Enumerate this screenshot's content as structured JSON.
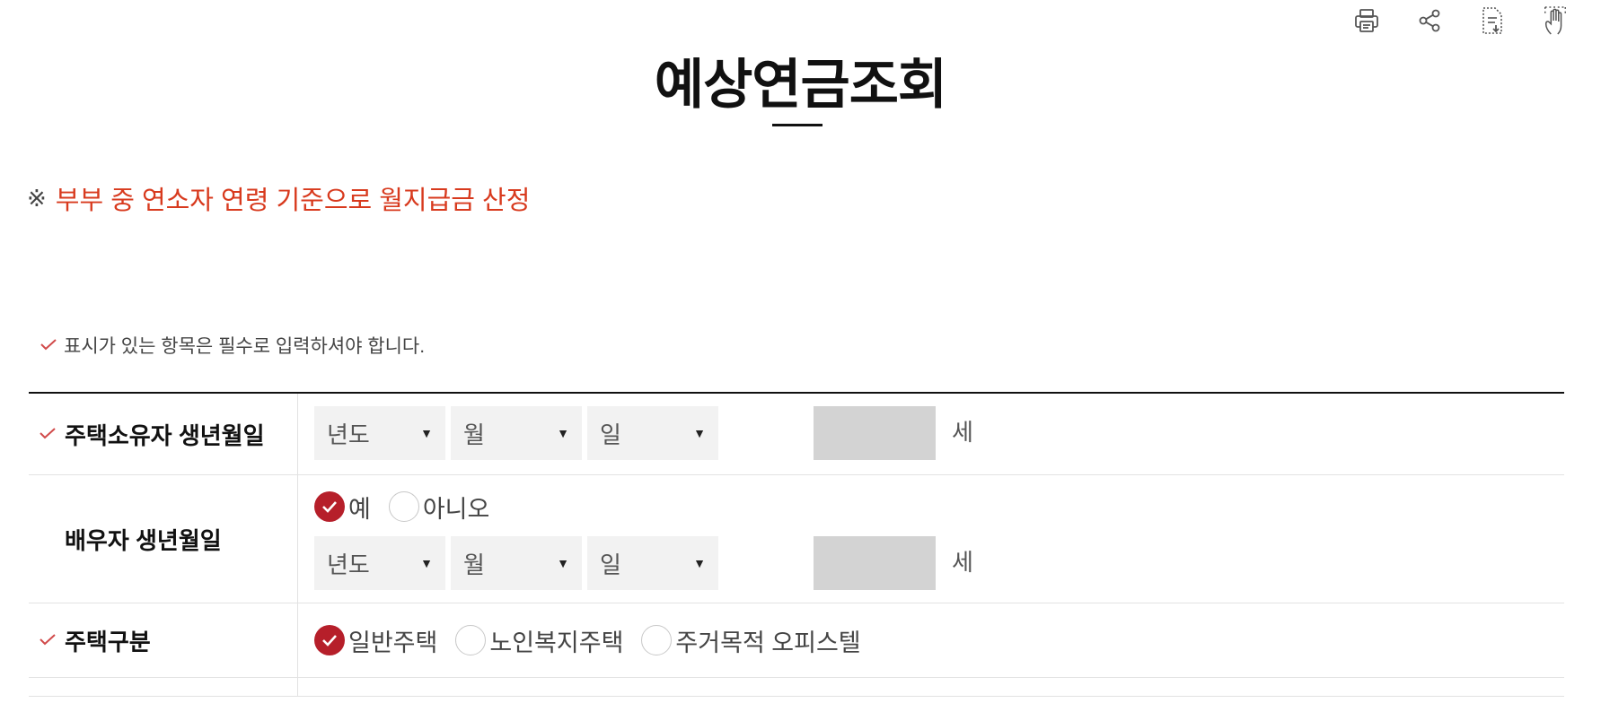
{
  "page": {
    "title": "예상연금조회",
    "notice_mark": "※",
    "notice_text": "부부 중 연소자 연령 기준으로 월지급금 산정",
    "required_note": "표시가 있는 항목은 필수로 입력하셔야 합니다."
  },
  "toolbar": {
    "icons": [
      "print-icon",
      "share-icon",
      "download-document-icon",
      "touch-hand-icon"
    ]
  },
  "form": {
    "owner_birth": {
      "label": "주택소유자 생년월일",
      "required": true,
      "year_placeholder": "년도",
      "month_placeholder": "월",
      "day_placeholder": "일",
      "age_value": "",
      "age_unit": "세"
    },
    "spouse_birth": {
      "label": "배우자 생년월일",
      "required": false,
      "options": [
        "예",
        "아니오"
      ],
      "selected": "예",
      "year_placeholder": "년도",
      "month_placeholder": "월",
      "day_placeholder": "일",
      "age_value": "",
      "age_unit": "세"
    },
    "house_type": {
      "label": "주택구분",
      "required": true,
      "options": [
        "일반주택",
        "노인복지주택",
        "주거목적 오피스텔"
      ],
      "selected": "일반주택"
    }
  },
  "colors": {
    "accent": "#b61f2a",
    "notice": "#d83a1e",
    "required_check": "#d14a4a"
  }
}
